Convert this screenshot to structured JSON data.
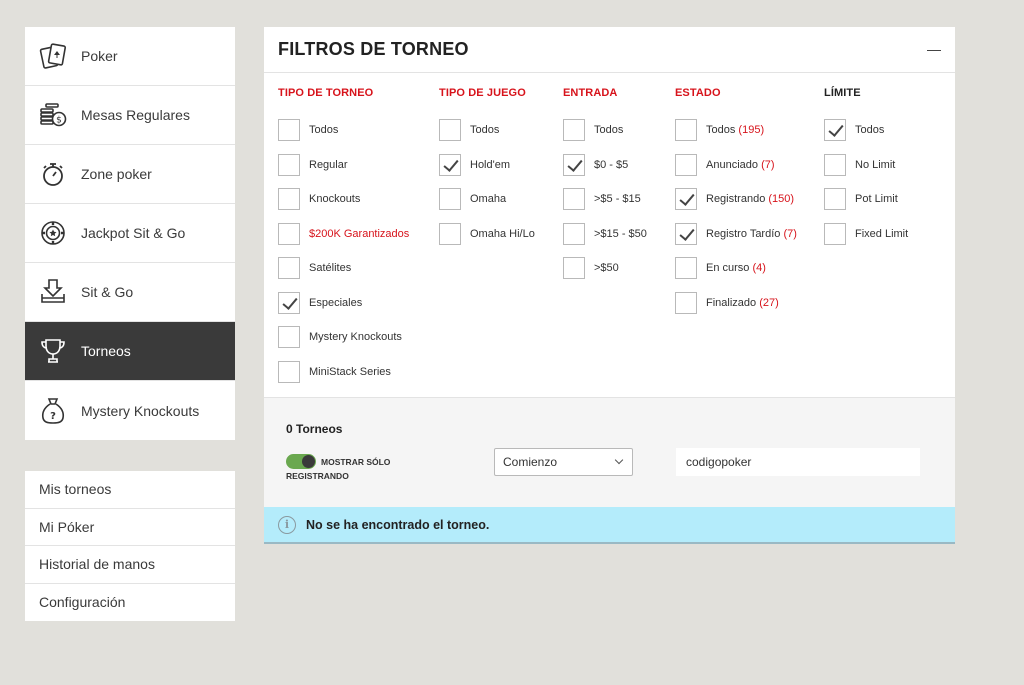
{
  "game_menu": [
    {
      "label": "Poker",
      "icon": "cards-icon",
      "active": false
    },
    {
      "label": "Mesas Regulares",
      "icon": "chips-icon",
      "active": false
    },
    {
      "label": "Zone poker",
      "icon": "stopwatch-icon",
      "active": false
    },
    {
      "label": "Jackpot Sit & Go",
      "icon": "jackpot-chip-icon",
      "active": false
    },
    {
      "label": "Sit & Go",
      "icon": "download-tray-icon",
      "active": false
    },
    {
      "label": "Torneos",
      "icon": "trophy-icon",
      "active": true
    },
    {
      "label": "Mystery Knockouts",
      "icon": "mystery-bag-icon",
      "active": false
    }
  ],
  "sub_menu": [
    "Mis torneos",
    "Mi Póker",
    "Historial de manos",
    "Configuración"
  ],
  "panel": {
    "title": "FILTROS DE TORNEO",
    "columns": {
      "tipo_torneo": {
        "title": "TIPO DE TORNEO",
        "options": [
          {
            "label": "Todos",
            "checked": false
          },
          {
            "label": "Regular",
            "checked": false
          },
          {
            "label": "Knockouts",
            "checked": false
          },
          {
            "label": "$200K Garantizados",
            "checked": false,
            "highlight": true
          },
          {
            "label": "Satélites",
            "checked": false
          },
          {
            "label": "Especiales",
            "checked": true
          },
          {
            "label": "Mystery Knockouts",
            "checked": false
          },
          {
            "label": "MiniStack Series",
            "checked": false
          }
        ]
      },
      "tipo_juego": {
        "title": "TIPO DE JUEGO",
        "options": [
          {
            "label": "Todos",
            "checked": false
          },
          {
            "label": "Hold'em",
            "checked": true
          },
          {
            "label": "Omaha",
            "checked": false
          },
          {
            "label": "Omaha Hi/Lo",
            "checked": false
          }
        ]
      },
      "entrada": {
        "title": "ENTRADA",
        "options": [
          {
            "label": "Todos",
            "checked": false
          },
          {
            "label": "$0 - $5",
            "checked": true
          },
          {
            "label": ">$5 - $15",
            "checked": false
          },
          {
            "label": ">$15 - $50",
            "checked": false
          },
          {
            "label": ">$50",
            "checked": false
          }
        ]
      },
      "estado": {
        "title": "ESTADO",
        "options": [
          {
            "label": "Todos",
            "count": "(195)",
            "checked": false
          },
          {
            "label": "Anunciado",
            "count": "(7)",
            "checked": false
          },
          {
            "label": "Registrando",
            "count": "(150)",
            "checked": true
          },
          {
            "label": "Registro Tardío",
            "count": "(7)",
            "checked": true
          },
          {
            "label": "En curso",
            "count": "(4)",
            "checked": false
          },
          {
            "label": "Finalizado",
            "count": "(27)",
            "checked": false
          }
        ]
      },
      "limite": {
        "title": "LÍMITE",
        "options": [
          {
            "label": "Todos",
            "checked": true
          },
          {
            "label": "No Limit",
            "checked": false
          },
          {
            "label": "Pot Limit",
            "checked": false
          },
          {
            "label": "Fixed Limit",
            "checked": false
          }
        ]
      }
    },
    "result_count": "0 Torneos",
    "toggle": {
      "line1": "MOSTRAR SÓLO",
      "line2": "REGISTRANDO",
      "on": true
    },
    "sort_select": {
      "value": "Comienzo"
    },
    "search": {
      "value": "codigopoker"
    },
    "notice": "No se ha encontrado el torneo.",
    "colors": {
      "accent_red": "#d7131b",
      "active_bg": "#3a3a3a",
      "notice_bg": "#b4ecfb",
      "toggle_green": "#6aa84f"
    }
  }
}
